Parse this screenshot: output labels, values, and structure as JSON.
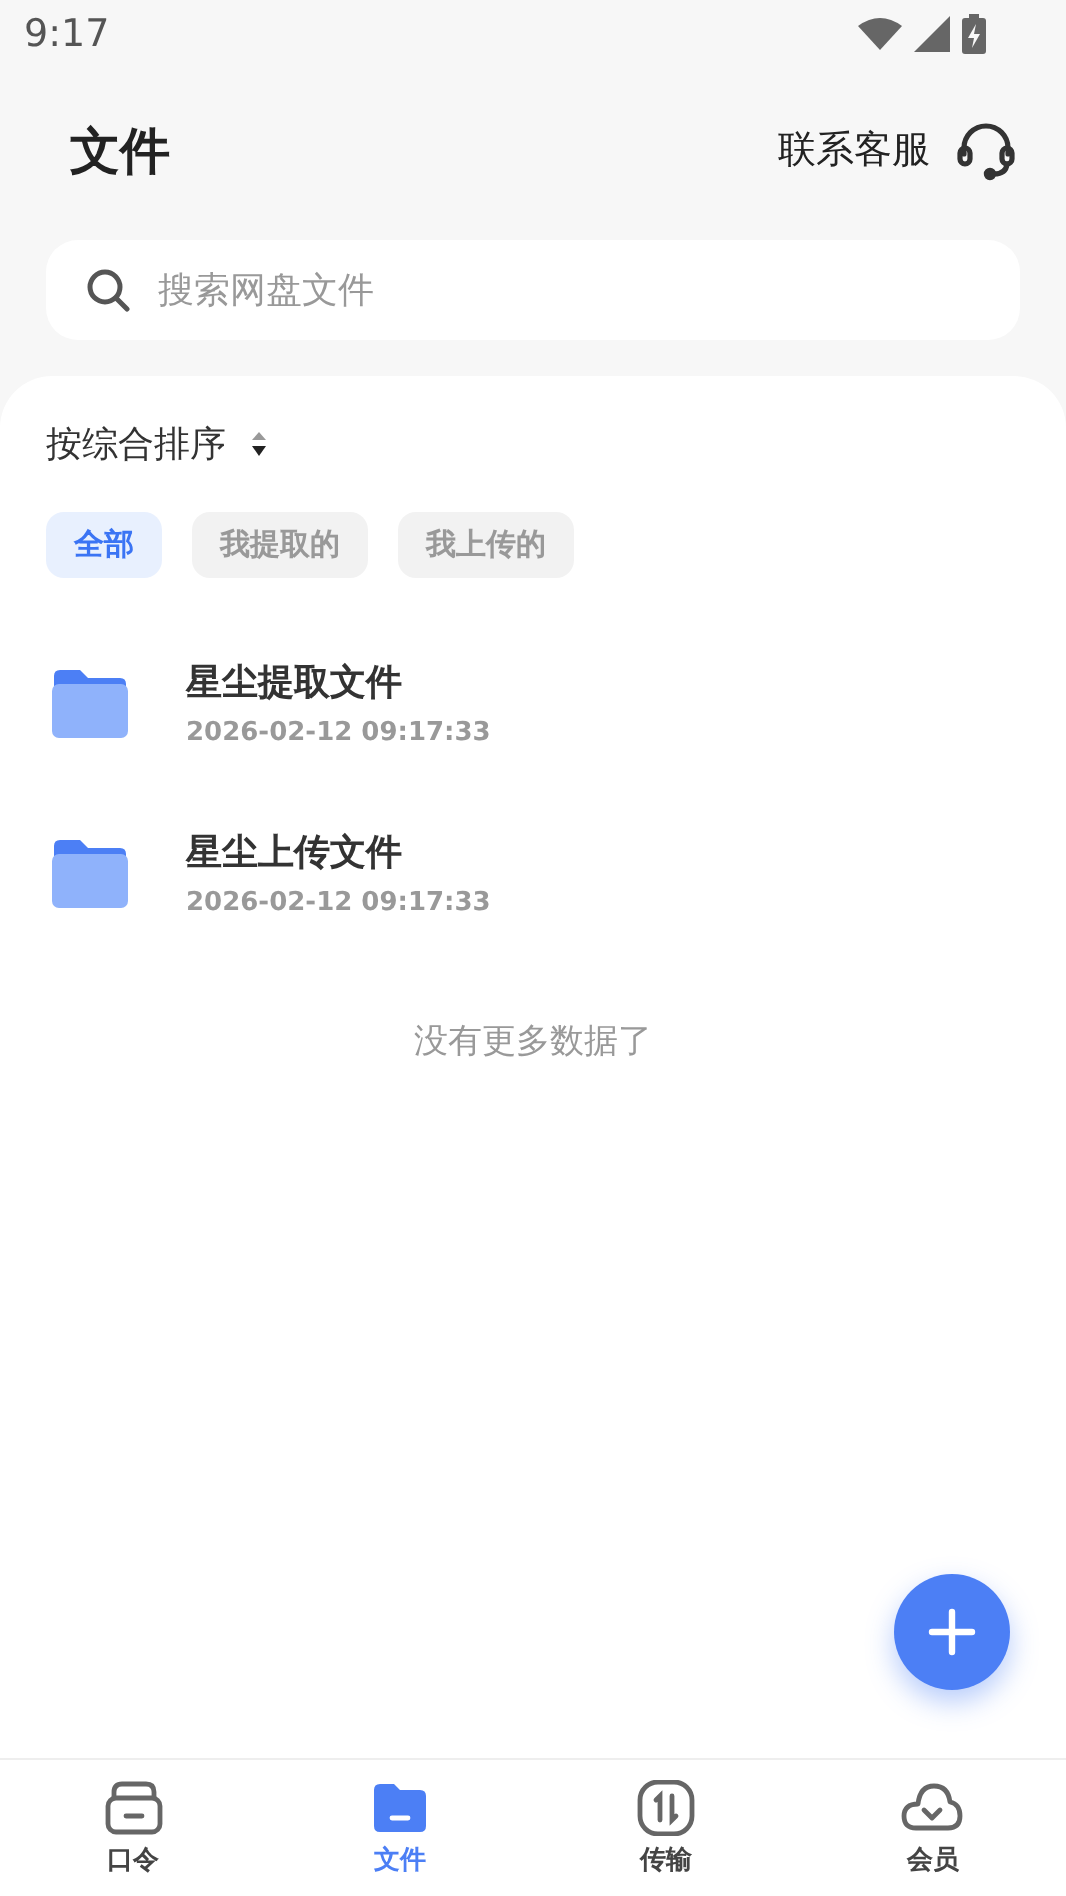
{
  "status_bar": {
    "time": "9:17"
  },
  "header": {
    "title": "文件",
    "support_label": "联系客服"
  },
  "search": {
    "placeholder": "搜索网盘文件"
  },
  "sort": {
    "label": "按综合排序"
  },
  "filters": [
    {
      "label": "全部",
      "selected": true
    },
    {
      "label": "我提取的",
      "selected": false
    },
    {
      "label": "我上传的",
      "selected": false
    }
  ],
  "files": [
    {
      "name": "星尘提取文件",
      "date": "2026-02-12 09:17:33"
    },
    {
      "name": "星尘上传文件",
      "date": "2026-02-12 09:17:33"
    }
  ],
  "end_note": "没有更多数据了",
  "bottom_nav": [
    {
      "label": "口令",
      "selected": false
    },
    {
      "label": "文件",
      "selected": true
    },
    {
      "label": "传输",
      "selected": false
    },
    {
      "label": "会员",
      "selected": false
    }
  ]
}
